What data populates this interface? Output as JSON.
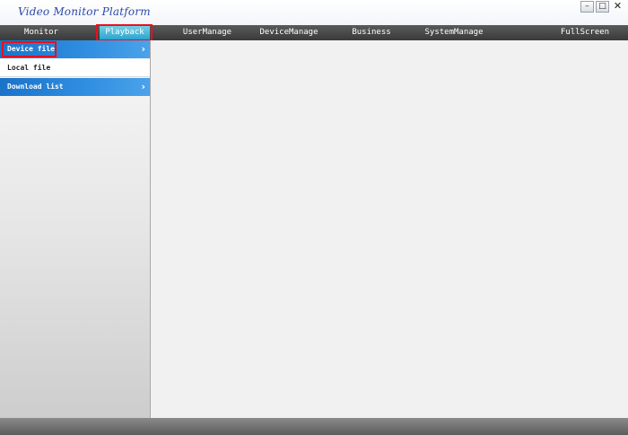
{
  "window": {
    "title": "Video Monitor Platform",
    "controls": {
      "minimize": "–",
      "maximize": "□",
      "close": "✕"
    }
  },
  "nav": {
    "items": [
      "Monitor",
      "Playback",
      "UserManage",
      "DeviceManage",
      "Business",
      "SystemManage",
      "FullScreen"
    ],
    "active": "Playback"
  },
  "sidebar": {
    "items": [
      {
        "label": "Device file",
        "style": "blue",
        "chevron": "›"
      },
      {
        "label": "Local file",
        "style": "plain"
      },
      {
        "label": "Download list",
        "style": "blue",
        "chevron": "›"
      }
    ]
  },
  "colors": {
    "highlight": "#e8101e",
    "nav_bg": "#484848",
    "sidebar_blue": "#2f8de0",
    "active_tab": "#2b9fc9"
  }
}
